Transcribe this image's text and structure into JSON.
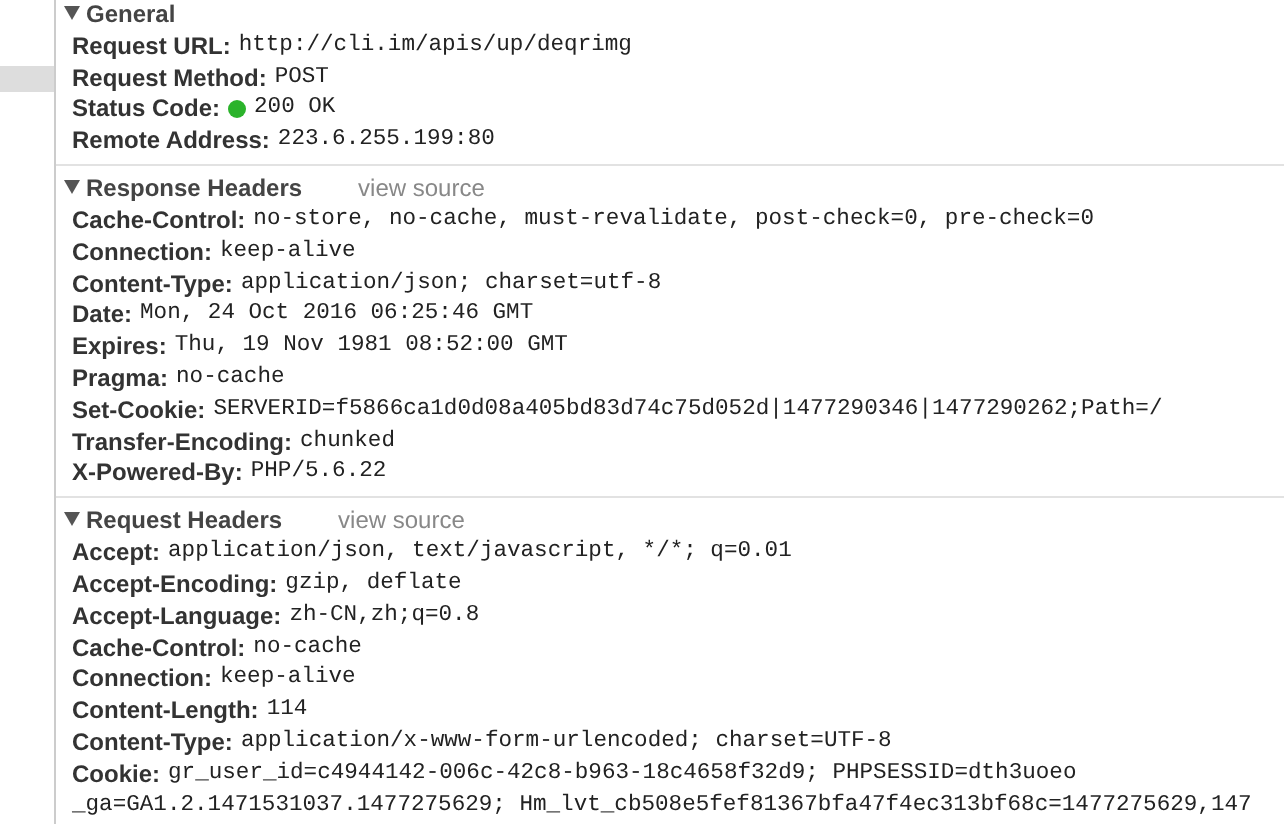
{
  "sections": [
    {
      "title": "General",
      "rows": [
        {
          "name": "Request URL:",
          "value": "http://cli.im/apis/up/deqrimg"
        },
        {
          "name": "Request Method:",
          "value": "POST"
        },
        {
          "name": "Status Code:",
          "value": "200 OK",
          "color": "#2bb32b"
        },
        {
          "name": "Remote Address:",
          "value": "223.6.255.199:80"
        }
      ]
    },
    {
      "title": "Response Headers",
      "view_source": "view source",
      "rows": [
        {
          "name": "Cache-Control:",
          "value": "no-store, no-cache, must-revalidate, post-check=0, pre-check=0"
        },
        {
          "name": "Connection:",
          "value": "keep-alive"
        },
        {
          "name": "Content-Type:",
          "value": "application/json; charset=utf-8"
        },
        {
          "name": "Date:",
          "value": "Mon, 24 Oct 2016 06:25:46 GMT"
        },
        {
          "name": "Expires:",
          "value": "Thu, 19 Nov 1981 08:52:00 GMT"
        },
        {
          "name": "Pragma:",
          "value": "no-cache"
        },
        {
          "name": "Set-Cookie:",
          "value": "SERVERID=f5866ca1d0d08a405bd83d74c75d052d|1477290346|1477290262;Path=/"
        },
        {
          "name": "Transfer-Encoding:",
          "value": "chunked"
        },
        {
          "name": "X-Powered-By:",
          "value": "PHP/5.6.22"
        }
      ]
    },
    {
      "title": "Request Headers",
      "view_source": "view source",
      "rows": [
        {
          "name": "Accept:",
          "value": "application/json, text/javascript, */*; q=0.01"
        },
        {
          "name": "Accept-Encoding:",
          "value": "gzip, deflate"
        },
        {
          "name": "Accept-Language:",
          "value": "zh-CN,zh;q=0.8"
        },
        {
          "name": "Cache-Control:",
          "value": "no-cache"
        },
        {
          "name": "Connection:",
          "value": "keep-alive"
        },
        {
          "name": "Content-Length:",
          "value": "114"
        },
        {
          "name": "Content-Type:",
          "value": "application/x-www-form-urlencoded; charset=UTF-8"
        },
        {
          "name": "Cookie:",
          "value": "gr_user_id=c4944142-006c-42c8-b963-18c4658f32d9; PHPSESSID=dth3uoeo",
          "continuation": "_ga=GA1.2.1471531037.1477275629; Hm_lvt_cb508e5fef81367bfa47f4ec313bf68c=1477275629,147"
        }
      ]
    }
  ]
}
